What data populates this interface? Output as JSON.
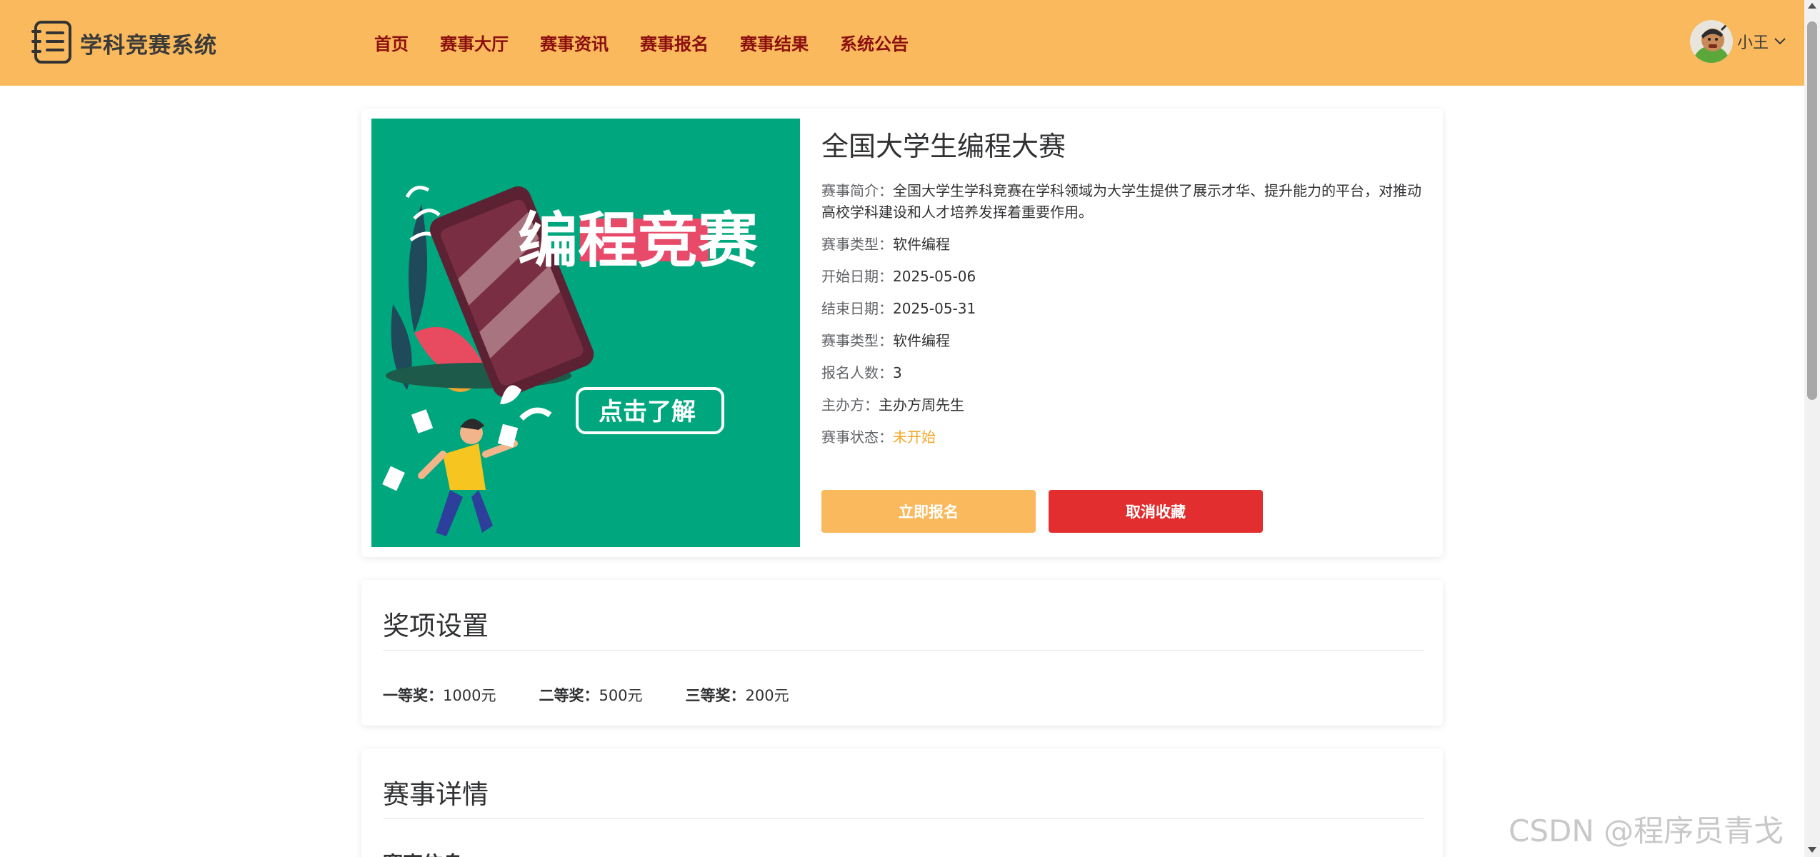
{
  "app": {
    "name": "学科竞赛系统"
  },
  "nav": [
    "首页",
    "赛事大厅",
    "赛事资讯",
    "赛事报名",
    "赛事结果",
    "系统公告"
  ],
  "user": {
    "name": "小王"
  },
  "competition": {
    "title": "全国大学生编程大赛",
    "poster": {
      "headline": "编程竞赛",
      "cta": "点击了解"
    },
    "info": [
      {
        "label": "赛事简介：",
        "value": "全国大学生学科竞赛在学科领域为大学生提供了展示才华、提升能力的平台，对推动高校学科建设和人才培养发挥着重要作用。"
      },
      {
        "label": "赛事类型：",
        "value": "软件编程"
      },
      {
        "label": "开始日期：",
        "value": "2025-05-06"
      },
      {
        "label": "结束日期：",
        "value": "2025-05-31"
      },
      {
        "label": "赛事类型：",
        "value": "软件编程"
      },
      {
        "label": "报名人数：",
        "value": "3"
      },
      {
        "label": "主办方：",
        "value": "主办方周先生"
      },
      {
        "label": "赛事状态：",
        "value": "未开始"
      }
    ],
    "buttons": {
      "signup": "立即报名",
      "cancel_fav": "取消收藏"
    }
  },
  "prizes": {
    "title": "奖项设置",
    "items": [
      {
        "label": "一等奖：",
        "value": "1000元"
      },
      {
        "label": "二等奖：",
        "value": "500元"
      },
      {
        "label": "三等奖：",
        "value": "200元"
      }
    ]
  },
  "details": {
    "title": "赛事详情",
    "subtitle": "赛事信息"
  },
  "watermark": "CSDN @程序员青戈",
  "colors": {
    "header": "#f9b95c",
    "nav_text": "#8b0f0f",
    "danger": "#e22e2e",
    "status": "#f5a623",
    "poster_bg": "#00a77e"
  }
}
